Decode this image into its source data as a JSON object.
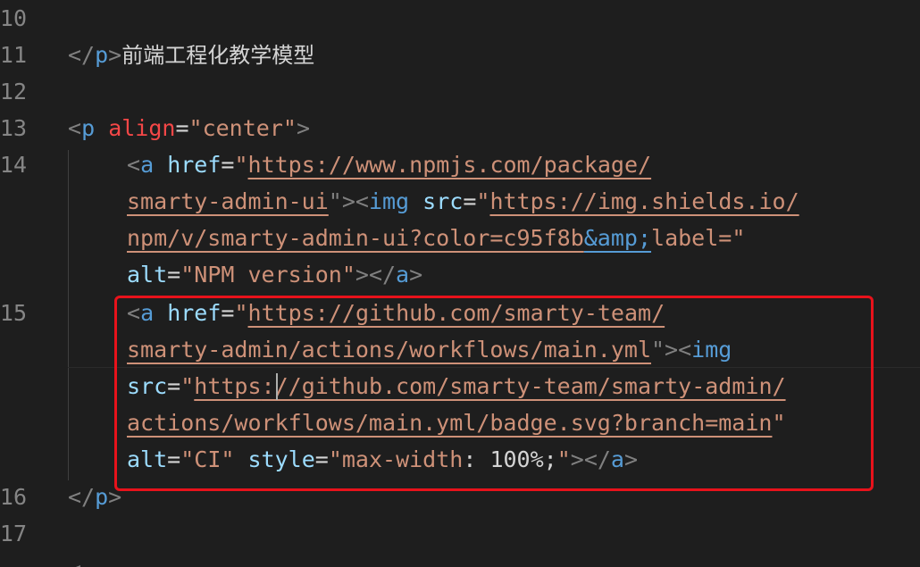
{
  "line_numbers": {
    "n10": "10",
    "n11": "11",
    "n12": "12",
    "n13": "13",
    "n14": "14",
    "n15": "15",
    "n16": "16",
    "n17": "17"
  },
  "code": {
    "l10_text": "前端工程化教学模型",
    "l11_close_p": "</p>",
    "l13": {
      "open": "<",
      "tag": "p",
      "attr": "align",
      "eq": "=",
      "value": "\"center\"",
      "close": ">"
    },
    "l14": {
      "a_open": "<",
      "a_tag": "a",
      "href_attr": "href",
      "eq": "=",
      "quote": "\"",
      "href_url_1": "https://www.npmjs.com/package/",
      "href_url_2": "smarty-admin-ui",
      "mid_1": "\">",
      "img_open": "<",
      "img_tag": "img",
      "src_attr": "src",
      "src_url_1": "https://img.shields.io/",
      "src_url_2": "npm/v/smarty-admin-ui?color=c95f8b",
      "entity": "&amp;",
      "src_url_3": "label=",
      "alt_attr": "alt",
      "alt_value": "\"NPM version\"",
      "end": "></",
      "end_tag": "a",
      "end_close": ">"
    },
    "l15": {
      "href_url_1": "https://github.com/smarty-team/",
      "href_url_2": "smarty-admin/actions/workflows/main.yml",
      "src_url_1a": "https",
      "src_url_1b": "://github.com/smarty-team/smarty-admin/",
      "src_url_2": "actions/workflows/main.yml/badge.svg?branch=main",
      "alt_value": "\"CI\"",
      "style_attr": "style",
      "style_value_1": "\"max-width",
      "style_value_2": ": 100%;",
      "style_value_3": "\""
    },
    "l16_close_p": "</p>"
  },
  "colors": {
    "background": "#1e1e1e",
    "selection_border": "#e8121b",
    "tag": "#569cd6",
    "attribute": "#9cdcfe",
    "string": "#ce9178"
  }
}
